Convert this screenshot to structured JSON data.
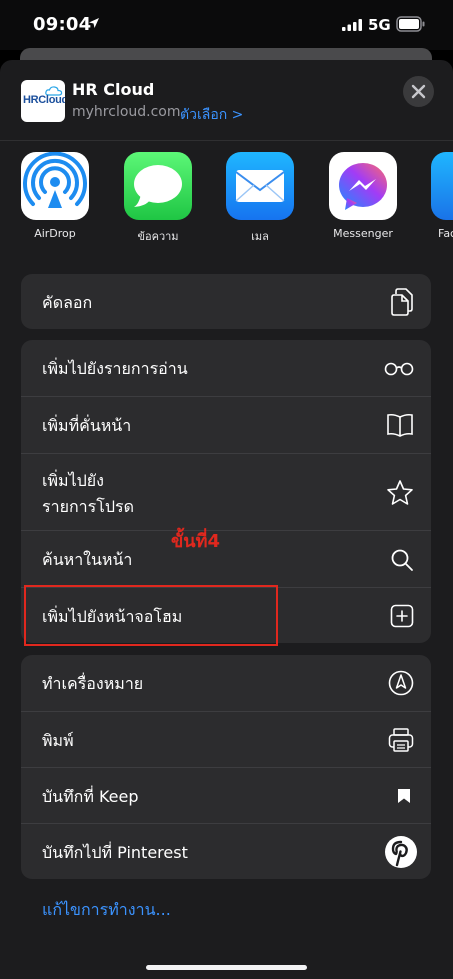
{
  "status_bar": {
    "time": "09:04",
    "network": "5G"
  },
  "header": {
    "thumb_text": "HRCloud",
    "title": "HR Cloud",
    "url": "myhrcloud.com",
    "options_label": "ตัวเลือก >"
  },
  "apps": [
    {
      "label": "AirDrop",
      "icon": "airdrop-icon"
    },
    {
      "label": "ข้อความ",
      "icon": "messages-icon"
    },
    {
      "label": "เมล",
      "icon": "mail-icon"
    },
    {
      "label": "Messenger",
      "icon": "messenger-icon"
    },
    {
      "label": "Fac",
      "icon": "facebook-icon"
    }
  ],
  "actions": {
    "copy": "คัดลอก",
    "add_reading_list": "เพิ่มไปยังรายการอ่าน",
    "add_bookmark": "เพิ่มที่คั่นหน้า",
    "add_favorites_line1": "เพิ่มไปยัง",
    "add_favorites_line2": "รายการโปรด",
    "find_on_page": "ค้นหาในหน้า",
    "add_home_screen": "เพิ่มไปยังหน้าจอโฮม",
    "markup": "ทำเครื่องหมาย",
    "print": "พิมพ์",
    "save_keep": "บันทึกที่ Keep",
    "save_pinterest": "บันทึกไปที่ Pinterest"
  },
  "edit_actions": "แก้ไขการทำงาน...",
  "annotation": {
    "step": "ขั้นที่4"
  },
  "colors": {
    "accent": "#3b93ff",
    "annotation": "#e0281e",
    "sheet": "#1c1c1e",
    "group": "#2c2c2e"
  }
}
